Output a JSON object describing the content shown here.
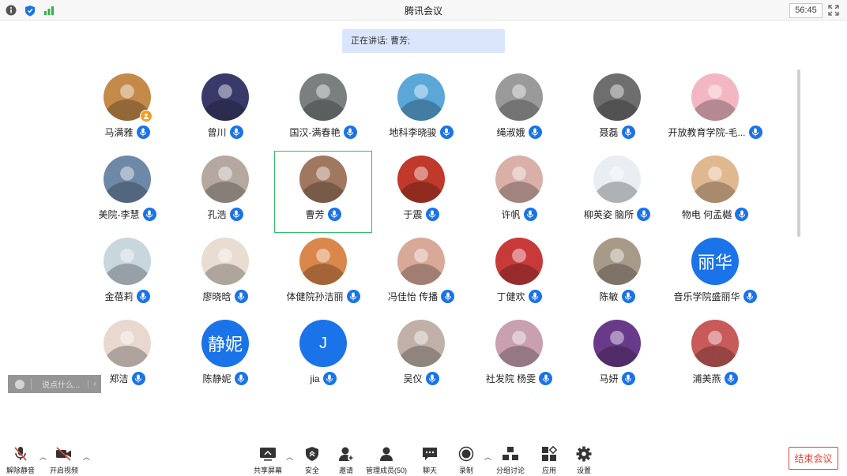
{
  "window": {
    "title": "腾讯会议",
    "timer": "56:45"
  },
  "speaking": {
    "label": "正在讲话: 曹芳;"
  },
  "participants": [
    {
      "name": "马满雅",
      "avatar_color": "#c48a4a",
      "host_badge": true
    },
    {
      "name": "曾川",
      "avatar_color": "#3a3a6a"
    },
    {
      "name": "国汉-满春艳",
      "avatar_color": "#7a7f80"
    },
    {
      "name": "地科李晓骏",
      "avatar_color": "#5aa7d8"
    },
    {
      "name": "绳淑娥",
      "avatar_color": "#9a9a9a"
    },
    {
      "name": "聂磊",
      "avatar_color": "#6e6e6e"
    },
    {
      "name": "开放教育学院-毛...",
      "avatar_color": "#f2b7c2"
    },
    {
      "name": "美院-李慧",
      "avatar_color": "#6e88a8"
    },
    {
      "name": "孔浩",
      "avatar_color": "#b4a8a0"
    },
    {
      "name": "曹芳",
      "avatar_color": "#a07860",
      "active": true
    },
    {
      "name": "于震",
      "avatar_color": "#c0392b"
    },
    {
      "name": "许帆",
      "avatar_color": "#d8b0a8"
    },
    {
      "name": "柳英姿 脑所",
      "avatar_color": "#e8eef2"
    },
    {
      "name": "物电 何孟樾",
      "avatar_color": "#e0b890"
    },
    {
      "name": "金蓓莉",
      "avatar_color": "#c8d6de"
    },
    {
      "name": "廖晓晗",
      "avatar_color": "#e8ddd0"
    },
    {
      "name": "体健院孙洁丽",
      "avatar_color": "#d9874a"
    },
    {
      "name": "冯佳怡 传播",
      "avatar_color": "#d8a898"
    },
    {
      "name": "丁健欢",
      "avatar_color": "#c83a3a"
    },
    {
      "name": "陈敏",
      "avatar_color": "#a89a88"
    },
    {
      "name": "音乐学院盛丽华",
      "avatar_color": "#1a73e8",
      "avatar_text": "丽华"
    },
    {
      "name": "郑洁",
      "avatar_color": "#e8d8d0"
    },
    {
      "name": "陈静妮",
      "avatar_color": "#1a73e8",
      "avatar_text": "静妮"
    },
    {
      "name": "jia",
      "avatar_color": "#1a73e8",
      "avatar_text": "J"
    },
    {
      "name": "吴仪",
      "avatar_color": "#c0b0a8"
    },
    {
      "name": "社发院 杨雯",
      "avatar_color": "#c8a0b0"
    },
    {
      "name": "马妍",
      "avatar_color": "#6a3a8a"
    },
    {
      "name": "浦美燕",
      "avatar_color": "#c85a5a"
    }
  ],
  "chat": {
    "placeholder": "说点什么..."
  },
  "toolbar": {
    "unmute": "解除静音",
    "start_video": "开启视频",
    "share_screen": "共享屏幕",
    "security": "安全",
    "invite": "邀请",
    "manage_members": "管理成员(50)",
    "chat": "聊天",
    "record": "录制",
    "breakout": "分组讨论",
    "apps": "应用",
    "settings": "设置",
    "end_meeting": "结束会议"
  }
}
